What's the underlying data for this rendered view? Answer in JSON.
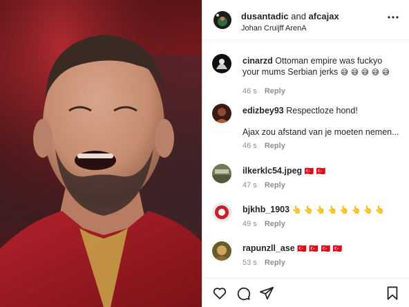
{
  "post": {
    "author": "dusantadic",
    "and_text": "and",
    "collaborator": "afcajax",
    "location": "Johan Cruijff ArenA"
  },
  "comments": [
    {
      "username": "cinarzd",
      "text_line1": "Ottoman empire was fuckyo",
      "text_line2": "your mums Serbian jerks",
      "emoji": "😅 😅 😅 😅 😅",
      "time": "46 s",
      "reply": "Reply",
      "avatar_icon": "profile-photo-icon"
    },
    {
      "username": "edizbey93",
      "text_line1": "Respectloze hond!",
      "extra_line": "Ajax zou afstand van je moeten nemen...",
      "time": "46 s",
      "reply": "Reply",
      "avatar_icon": "profile-photo-icon"
    },
    {
      "username": "ilkerklc54.jpeg",
      "text_line1": "",
      "emoji": "🇹🇷 🇹🇷",
      "time": "47 s",
      "reply": "Reply",
      "avatar_icon": "profile-photo-icon"
    },
    {
      "username": "bjkhb_1903",
      "text_line1": "",
      "emoji": "👆 👆 👆 👆 👆 👆 👆 👆",
      "time": "49 s",
      "reply": "Reply",
      "avatar_icon": "profile-photo-icon"
    },
    {
      "username": "rapunzll_ase",
      "text_line1": "",
      "emoji": "🇹🇷 🇹🇷 🇹🇷 🇹🇷",
      "time": "53 s",
      "reply": "Reply",
      "avatar_icon": "profile-photo-icon"
    }
  ],
  "icons": {
    "more": "more-options-icon",
    "like": "heart-icon",
    "comment": "comment-icon",
    "share": "send-icon",
    "save": "bookmark-icon"
  },
  "colors": {
    "text": "#262626",
    "muted": "#8e8e8e",
    "border": "#dbdbdb",
    "flag_red": "#e30a17"
  }
}
